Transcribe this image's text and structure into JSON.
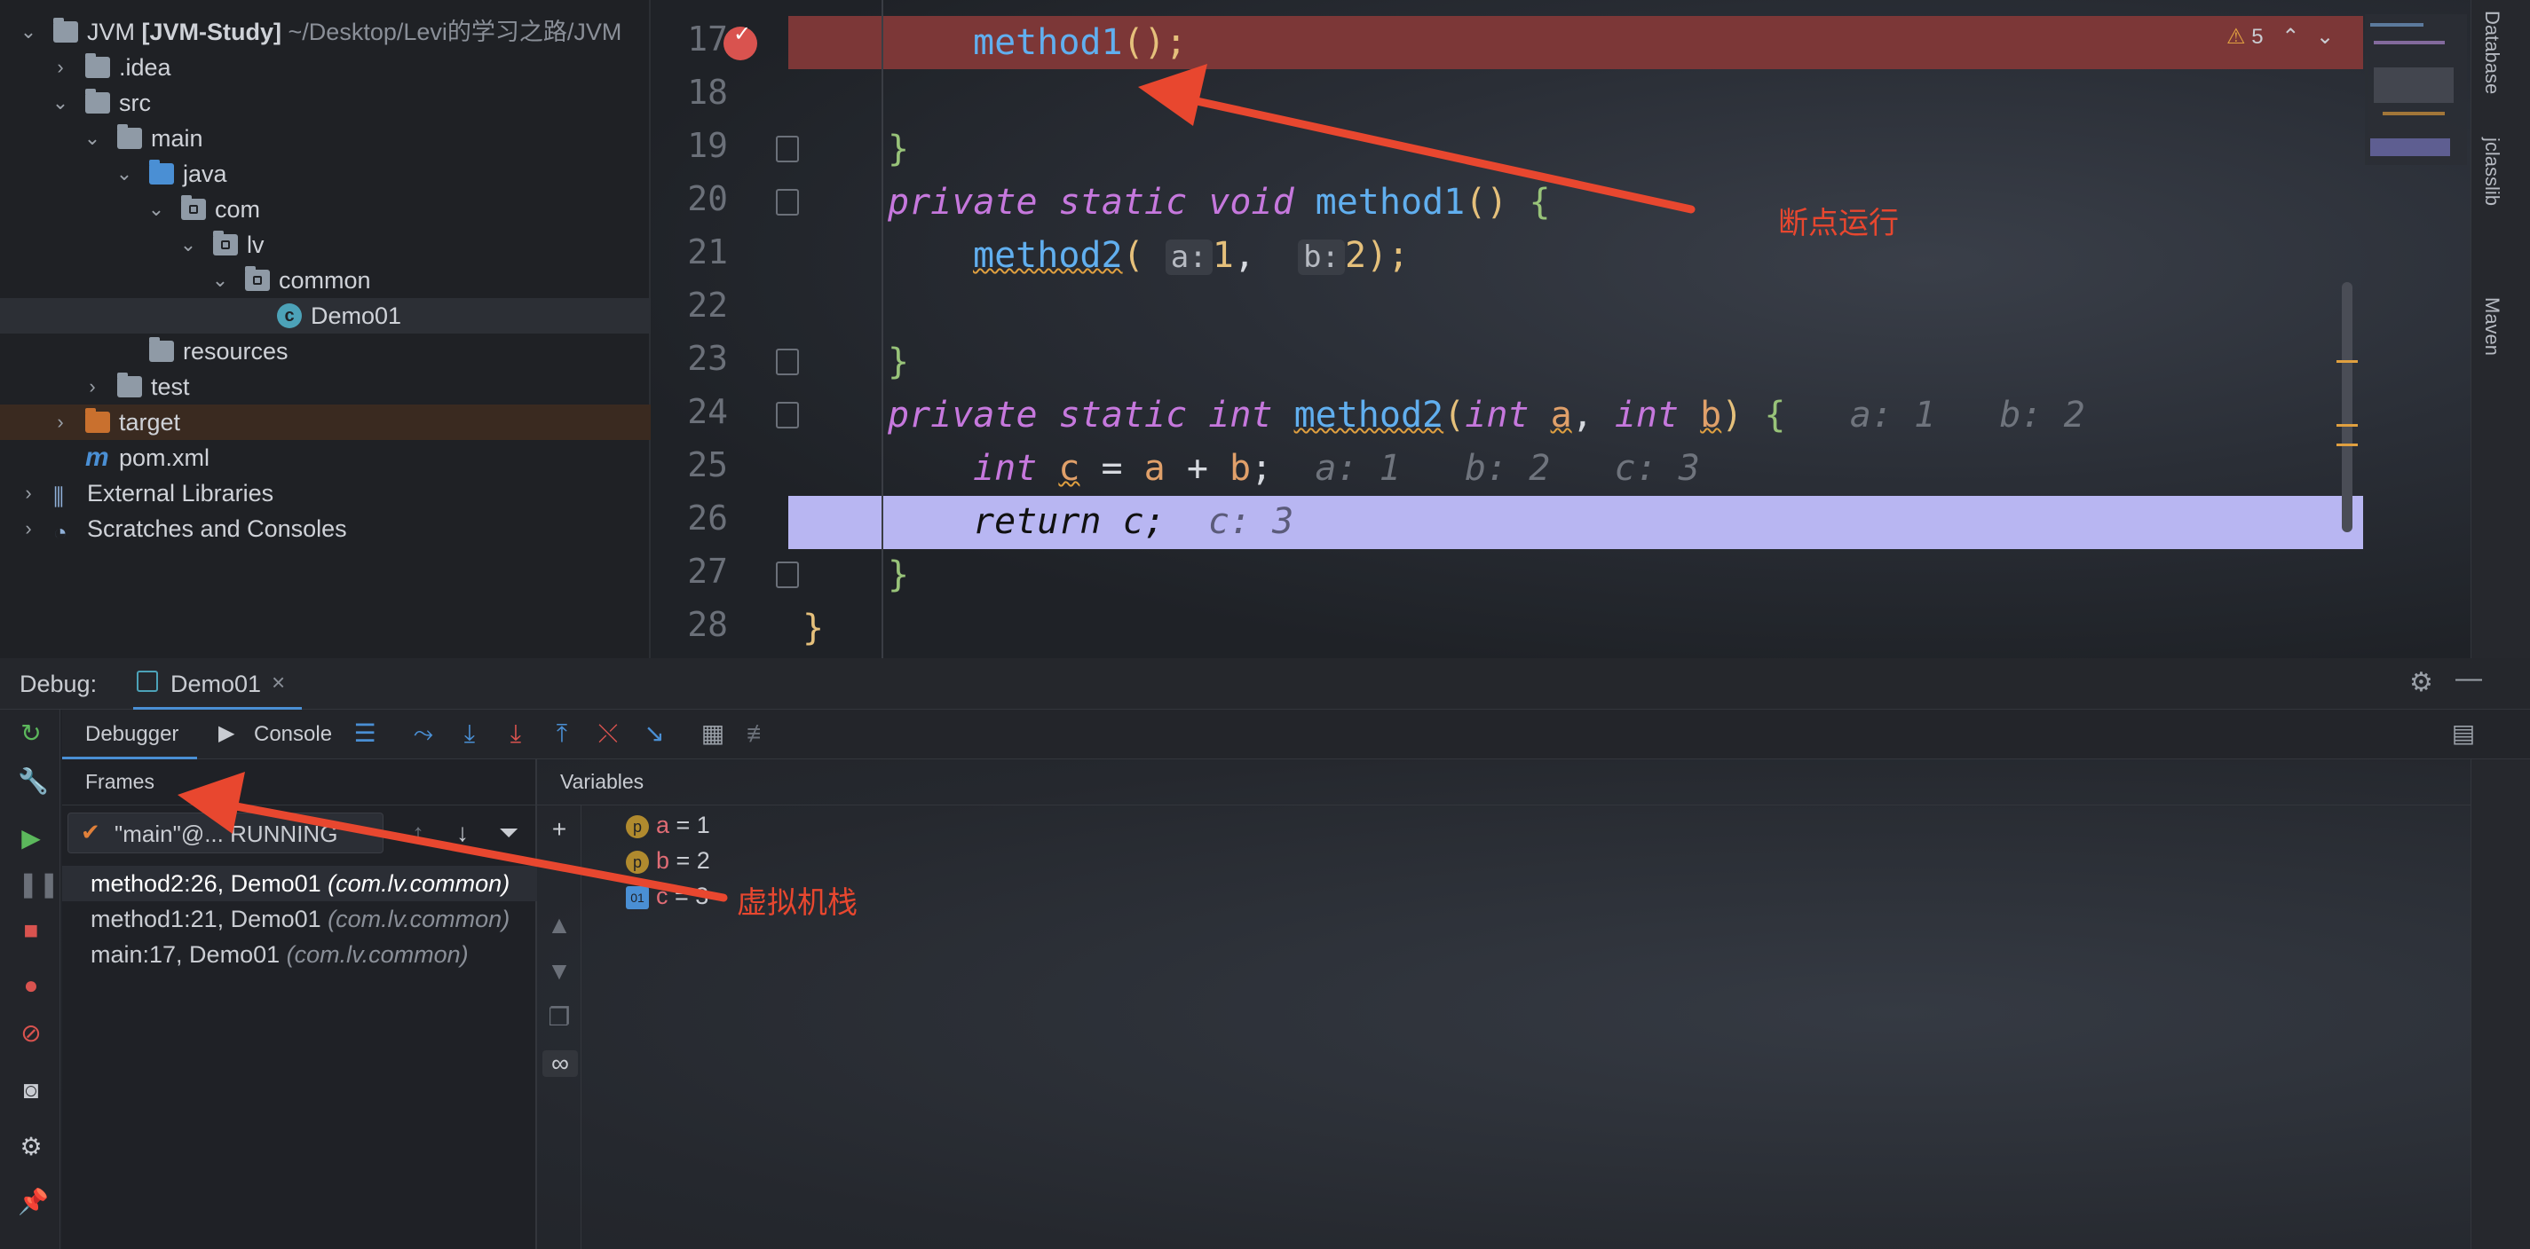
{
  "project_tree": [
    {
      "label": "JVM",
      "bold": "[JVM-Study]",
      "path": "~/Desktop/Levi的学习之路/JVM"
    },
    {
      "label": ".idea"
    },
    {
      "label": "src"
    },
    {
      "label": "main"
    },
    {
      "label": "java"
    },
    {
      "label": "com"
    },
    {
      "label": "lv"
    },
    {
      "label": "common"
    },
    {
      "label": "Demo01"
    },
    {
      "label": "resources"
    },
    {
      "label": "test"
    },
    {
      "label": "target"
    },
    {
      "label": "pom.xml"
    },
    {
      "label": "External Libraries"
    },
    {
      "label": "Scratches and Consoles"
    }
  ],
  "editor": {
    "line_numbers": [
      "17",
      "18",
      "19",
      "20",
      "21",
      "22",
      "23",
      "24",
      "25",
      "26",
      "27",
      "28"
    ],
    "warnings_count": "5",
    "code": {
      "l17_fn": "method1",
      "l17_rest": "();",
      "l19": "}",
      "l20_kw": "private static void ",
      "l20_fn": "method1",
      "l20_paren": "()",
      "l20_brace": " {",
      "l21_fn": "method2",
      "l21_open": "(",
      "l21_hint_a": "a:",
      "l21_val_a": "1",
      "l21_comma": ",",
      "l21_hint_b": "b:",
      "l21_val_b": "2",
      "l21_close": ");",
      "l23": "}",
      "l24_kw": "private static int ",
      "l24_fn": "method2",
      "l24_open": "(",
      "l24_int1": "int ",
      "l24_a": "a",
      "l24_comma": ", ",
      "l24_int2": "int ",
      "l24_b": "b",
      "l24_close": ")",
      "l24_brace": " {",
      "l24_hint": "a: 1   b: 2",
      "l25_kw": "int ",
      "l25_c": "c",
      "l25_eq": " = ",
      "l25_a": "a",
      "l25_plus": " + ",
      "l25_b": "b",
      "l25_semi": ";",
      "l25_hint": "a: 1   b: 2   c: 3",
      "l26_code": "return c;",
      "l26_hint": "c: 3",
      "l27": "}",
      "l28": "}"
    }
  },
  "right_strip": {
    "database": "Database",
    "jclasslib": "jclasslib",
    "maven": "Maven"
  },
  "debug": {
    "title": "Debug:",
    "session_tab": "Demo01",
    "tabs": {
      "debugger": "Debugger",
      "console": "Console"
    },
    "frames_title": "Frames",
    "variables_title": "Variables",
    "thread": "\"main\"@... RUNNING",
    "frames": [
      {
        "method": "method2:26, Demo01 ",
        "pkg": "(com.lv.common)"
      },
      {
        "method": "method1:21, Demo01 ",
        "pkg": "(com.lv.common)"
      },
      {
        "method": "main:17, Demo01 ",
        "pkg": "(com.lv.common)"
      }
    ],
    "variables": [
      {
        "badge": "p",
        "name": "a",
        "value": " = 1"
      },
      {
        "badge": "p",
        "name": "b",
        "value": " = 2"
      },
      {
        "badge": "01",
        "name": "c",
        "value": " = 3"
      }
    ]
  },
  "annotations": {
    "breakpoint_run": "断点运行",
    "jvm_stack": "虚拟机栈"
  },
  "colors": {
    "accent_red": "#e8472f",
    "breakpoint_line": "#7c3737",
    "exec_line": "#b8b6f2"
  }
}
